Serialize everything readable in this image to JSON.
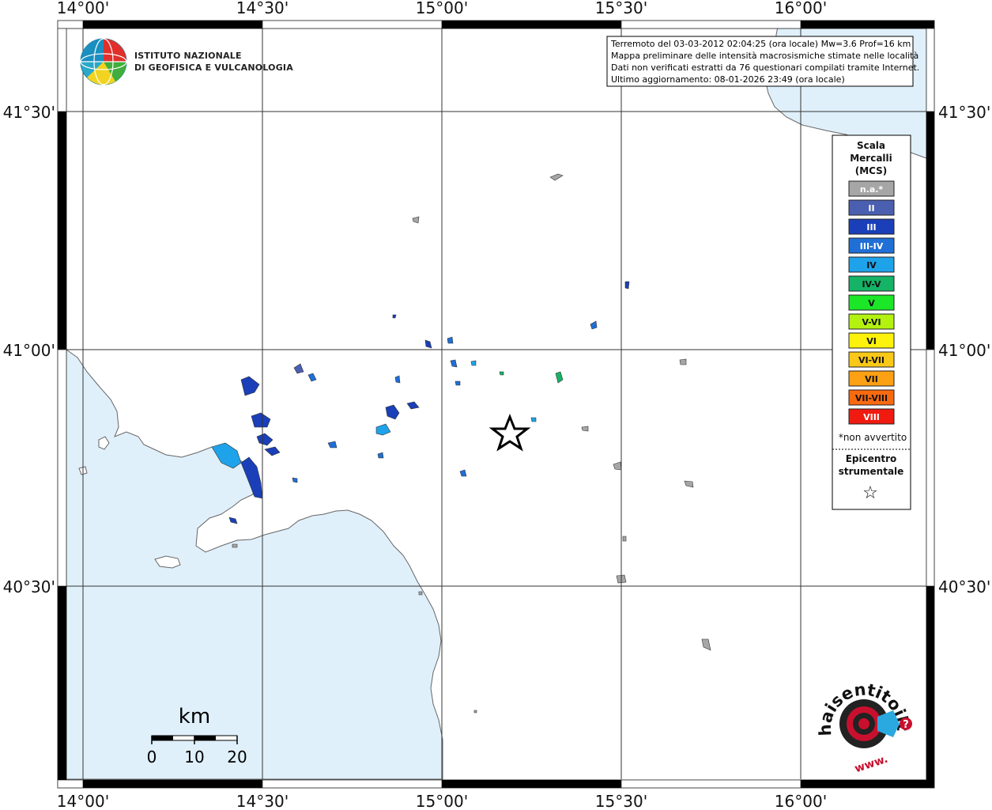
{
  "top_coordinates": [
    "14°00'",
    "14°30'",
    "15°00'",
    "15°30'",
    "16°00'"
  ],
  "bottom_coordinates": [
    "14°00'",
    "14°30'",
    "15°00'",
    "15°30'",
    "16°00'"
  ],
  "left_coordinates": [
    "41°30'",
    "41°00'",
    "40°30'"
  ],
  "right_coordinates": [
    "41°30'",
    "41°00'",
    "40°30'"
  ],
  "info_box": {
    "line1": "Terremoto del 03-03-2012 02:04:25 (ora locale) Mw=3.6 Prof=16 km",
    "line2": "Mappa preliminare delle intensità macrosismiche stimate nelle località",
    "line3": "Dati non verificati estratti da 76 questionari compilati tramite Internet.",
    "line4": "Ultimo aggiornamento: 08-01-2026 23:49 (ora locale)"
  },
  "ingv_logo": {
    "line1": "ISTITUTO NAZIONALE",
    "line2": "DI GEOFISICA E VULCANOLOGIA"
  },
  "legend": {
    "title1": "Scala",
    "title2": "Mercalli",
    "title3": "(MCS)",
    "classes": [
      {
        "label": "n.a.*",
        "color": "#a6a6a6"
      },
      {
        "label": "II",
        "color": "#4a5fb0"
      },
      {
        "label": "III",
        "color": "#1a3fb8"
      },
      {
        "label": "III-IV",
        "color": "#1f6fd6"
      },
      {
        "label": "IV",
        "color": "#1ea3ea"
      },
      {
        "label": "IV-V",
        "color": "#15b366"
      },
      {
        "label": "V",
        "color": "#1be627"
      },
      {
        "label": "V-VI",
        "color": "#b3f20f"
      },
      {
        "label": "VI",
        "color": "#fdf20b"
      },
      {
        "label": "VI-VII",
        "color": "#f9c818"
      },
      {
        "label": "VII",
        "color": "#fca014"
      },
      {
        "label": "VII-VIII",
        "color": "#f96a0f"
      },
      {
        "label": "VIII",
        "color": "#f01a10"
      }
    ],
    "not_felt_note": "*non avvertito",
    "epicenter1": "Epicentro",
    "epicenter2": "strumentale",
    "epicenter_symbol": "☆"
  },
  "scale_bar": {
    "unit": "km",
    "ticks": [
      "0",
      "10",
      "20"
    ]
  },
  "haisentito_logo": {
    "text": "haisentitoilterremoto.it",
    "www": "www.",
    "question": "?"
  },
  "colors": {
    "sea": "#e0f0fb",
    "coast": "#666666"
  }
}
